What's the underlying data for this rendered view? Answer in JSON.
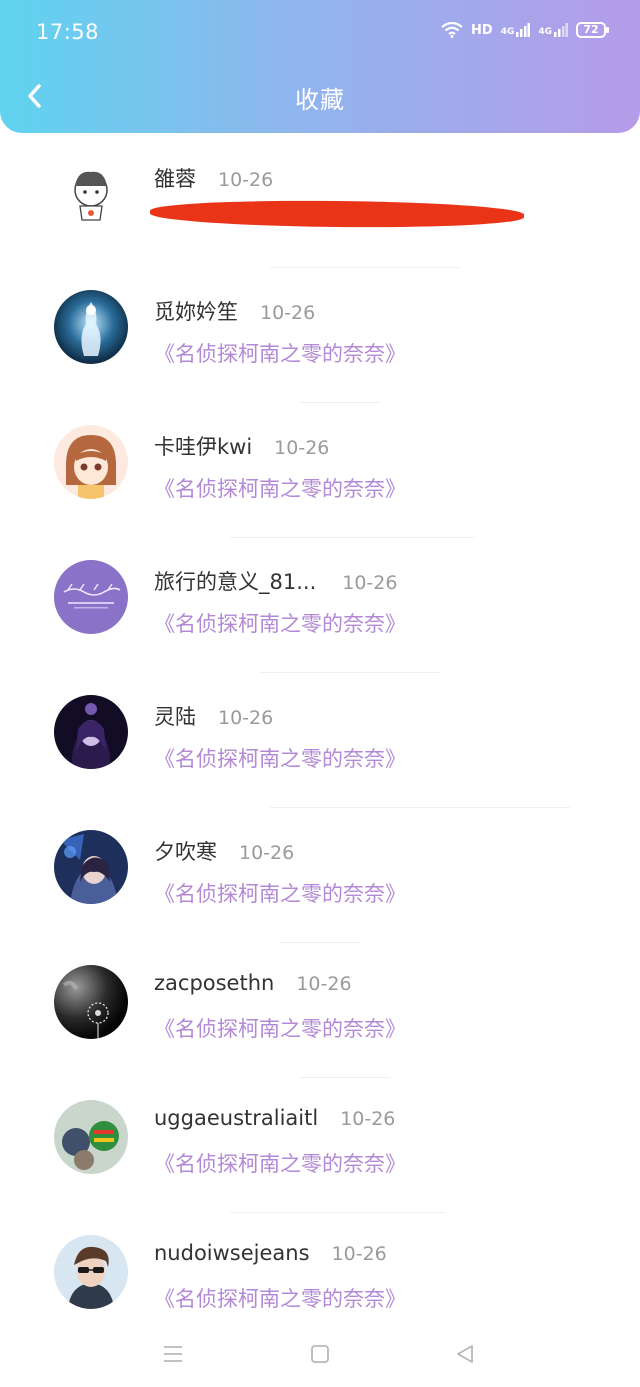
{
  "status_bar": {
    "time": "17:58",
    "network_label": "HD",
    "signal_label_1": "4G",
    "signal_label_2": "4G",
    "battery": "72"
  },
  "header": {
    "title": "收藏",
    "back_icon": "chevron-left-icon"
  },
  "colors": {
    "header_gradient_start": "#5fd3f0",
    "header_gradient_end": "#b59be9",
    "collection_title": "#b388d6",
    "redaction": "#ea3418"
  },
  "items": [
    {
      "username": "雒蓉",
      "date": "10-26",
      "title": "",
      "redacted": true
    },
    {
      "username": "觅妳妗笙",
      "date": "10-26",
      "title": "《名侦探柯南之零的奈奈》"
    },
    {
      "username": "卡哇伊kwi",
      "date": "10-26",
      "title": "《名侦探柯南之零的奈奈》"
    },
    {
      "username": "旅行的意义_81...",
      "date": "10-26",
      "title": "《名侦探柯南之零的奈奈》"
    },
    {
      "username": "灵陆",
      "date": "10-26",
      "title": "《名侦探柯南之零的奈奈》"
    },
    {
      "username": "夕吹寒",
      "date": "10-26",
      "title": "《名侦探柯南之零的奈奈》"
    },
    {
      "username": "zacposethn",
      "date": "10-26",
      "title": "《名侦探柯南之零的奈奈》"
    },
    {
      "username": "uggaeustraliaitl",
      "date": "10-26",
      "title": "《名侦探柯南之零的奈奈》"
    },
    {
      "username": "nudoiwsejeans",
      "date": "10-26",
      "title": "《名侦探柯南之零的奈奈》"
    }
  ],
  "navbar": {
    "menu_icon": "menu-icon",
    "home_icon": "square-home-icon",
    "back_icon": "triangle-back-icon"
  }
}
